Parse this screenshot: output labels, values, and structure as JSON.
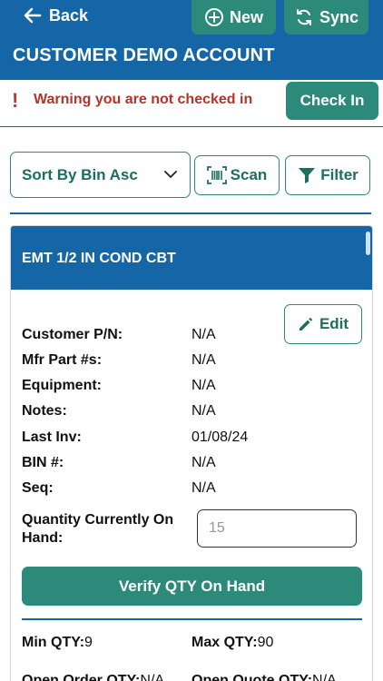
{
  "nav": {
    "back_label": "Back",
    "new_label": "New",
    "sync_label": "Sync",
    "account_title": "CUSTOMER DEMO ACCOUNT"
  },
  "warning": {
    "icon": "!",
    "text": "Warning you are not checked in",
    "check_in_label": "Check In"
  },
  "toolbar": {
    "sort_value": "Sort By Bin Asc",
    "scan_label": "Scan",
    "filter_label": "Filter"
  },
  "item": {
    "title": "EMT 1/2 IN COND CBT",
    "edit_label": "Edit",
    "fields": [
      {
        "label": "Customer P/N:",
        "value": "N/A"
      },
      {
        "label": "Mfr Part #s:",
        "value": "N/A"
      },
      {
        "label": "Equipment:",
        "value": "N/A"
      },
      {
        "label": "Notes:",
        "value": "N/A"
      },
      {
        "label": "Last Inv:",
        "value": "01/08/24"
      },
      {
        "label": "BIN #:",
        "value": "N/A"
      },
      {
        "label": "Seq:",
        "value": "N/A"
      }
    ],
    "qty_label": "Quantity Currently On Hand:",
    "qty_placeholder": "15",
    "verify_label": "Verify QTY On Hand",
    "min_label": "Min QTY:",
    "min_value": "9",
    "max_label": "Max QTY:",
    "max_value": "90",
    "open_order_label": "Open Order QTY:",
    "open_order_value": "N/A",
    "open_quote_label": "Open Quote QTY:",
    "open_quote_value": "N/A"
  },
  "colors": {
    "header_blue": "#1566a6",
    "teal": "#2b8a7a",
    "warning_red": "#b8322a"
  }
}
